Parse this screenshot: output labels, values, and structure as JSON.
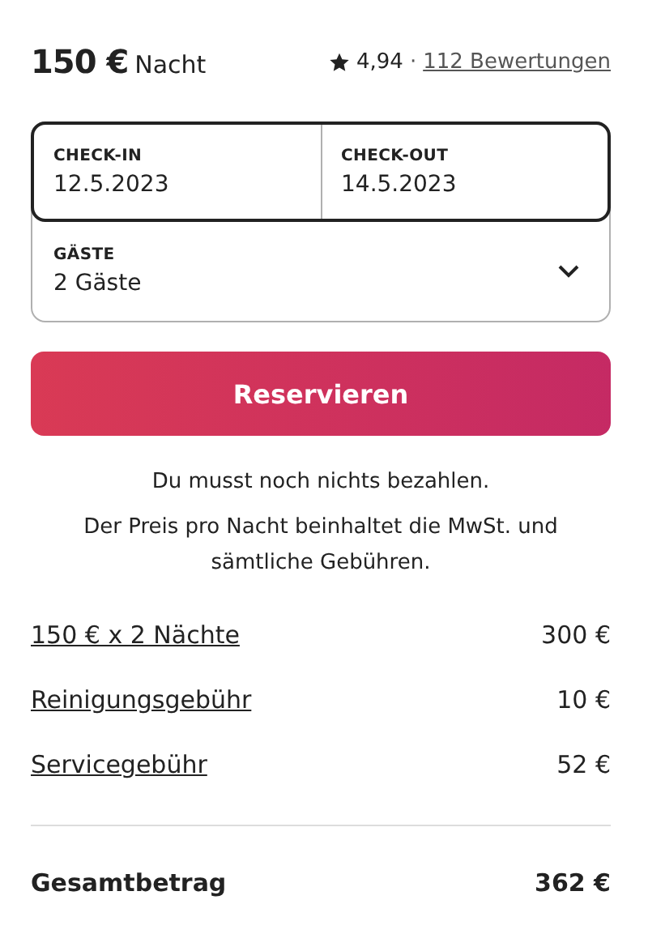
{
  "price": {
    "amount": "150 €",
    "unit": "Nacht"
  },
  "rating": {
    "score": "4,94",
    "separator": "·",
    "reviews": "112 Bewertungen"
  },
  "dates": [
    {
      "label": "CHECK-IN",
      "value": "12.5.2023"
    },
    {
      "label": "CHECK-OUT",
      "value": "14.5.2023"
    }
  ],
  "guests": {
    "label": "GÄSTE",
    "value": "2 Gäste"
  },
  "reserve_button": "Reservieren",
  "notes": [
    "Du musst noch nichts bezahlen.",
    "Der Preis pro Nacht beinhaltet die MwSt. und sämtliche Gebühren."
  ],
  "fees": [
    {
      "label": "150 € x 2 Nächte",
      "amount": "300 €"
    },
    {
      "label": "Reinigungsgebühr",
      "amount": "10 €"
    },
    {
      "label": "Servicegebühr",
      "amount": "52 €"
    }
  ],
  "total": {
    "label": "Gesamtbetrag",
    "amount": "362 €"
  }
}
